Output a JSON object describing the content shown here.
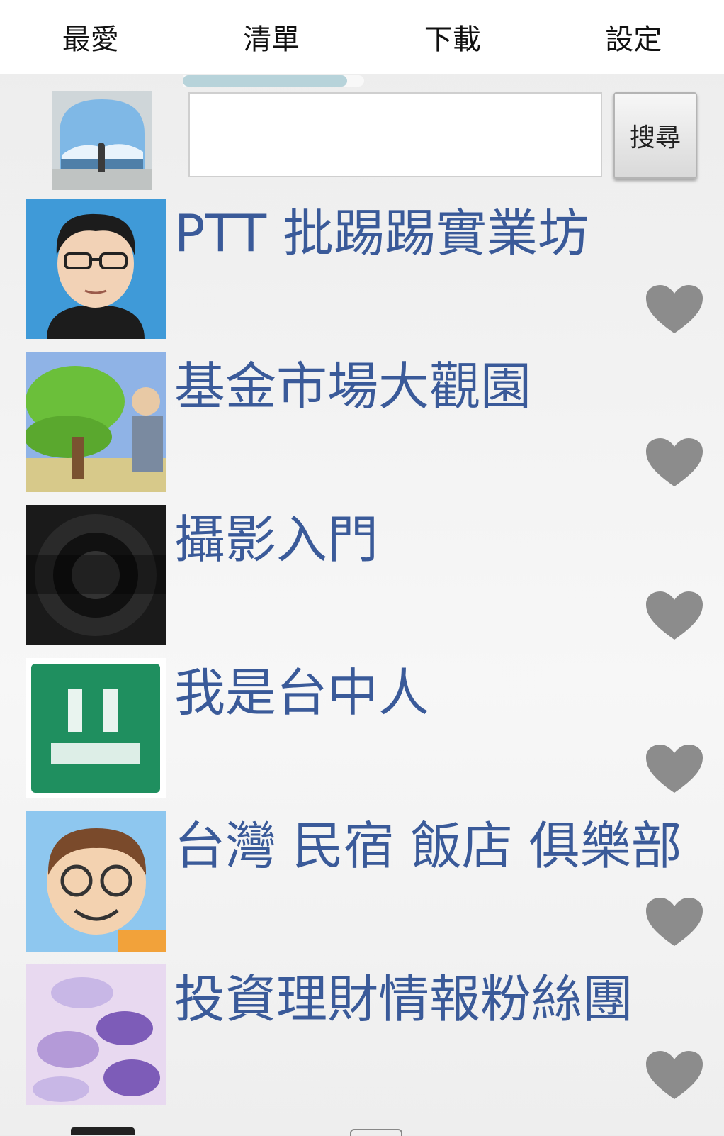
{
  "tabs": [
    {
      "label": "最愛"
    },
    {
      "label": "清單"
    },
    {
      "label": "下載"
    },
    {
      "label": "設定"
    }
  ],
  "search": {
    "value": "",
    "button_label": "搜尋"
  },
  "items": [
    {
      "title": "PTT 批踢踢實業坊",
      "thumb_colors": [
        "#3f9ad8",
        "#1c1c1c",
        "#f2d2b6"
      ]
    },
    {
      "title": "基金市場大觀園",
      "thumb_colors": [
        "#6bbf3a",
        "#8fb3e6",
        "#d7c98a"
      ]
    },
    {
      "title": "攝影入門",
      "thumb_colors": [
        "#1a1a1a",
        "#444444",
        "#cccccc"
      ]
    },
    {
      "title": "我是台中人",
      "thumb_colors": [
        "#1f8f5f",
        "#ffffff",
        "#ffffff"
      ]
    },
    {
      "title": "台灣 民宿 飯店 俱樂部",
      "thumb_colors": [
        "#8ec7ef",
        "#f3d2b0",
        "#7a4a2b"
      ]
    },
    {
      "title": "投資理財情報粉絲團",
      "thumb_colors": [
        "#c8b7e6",
        "#7d5cb8",
        "#e8d9f0"
      ]
    }
  ],
  "icons": {
    "heart": "heart-icon"
  },
  "colors": {
    "title": "#3a5a99",
    "heart": "#8c8c8c"
  }
}
